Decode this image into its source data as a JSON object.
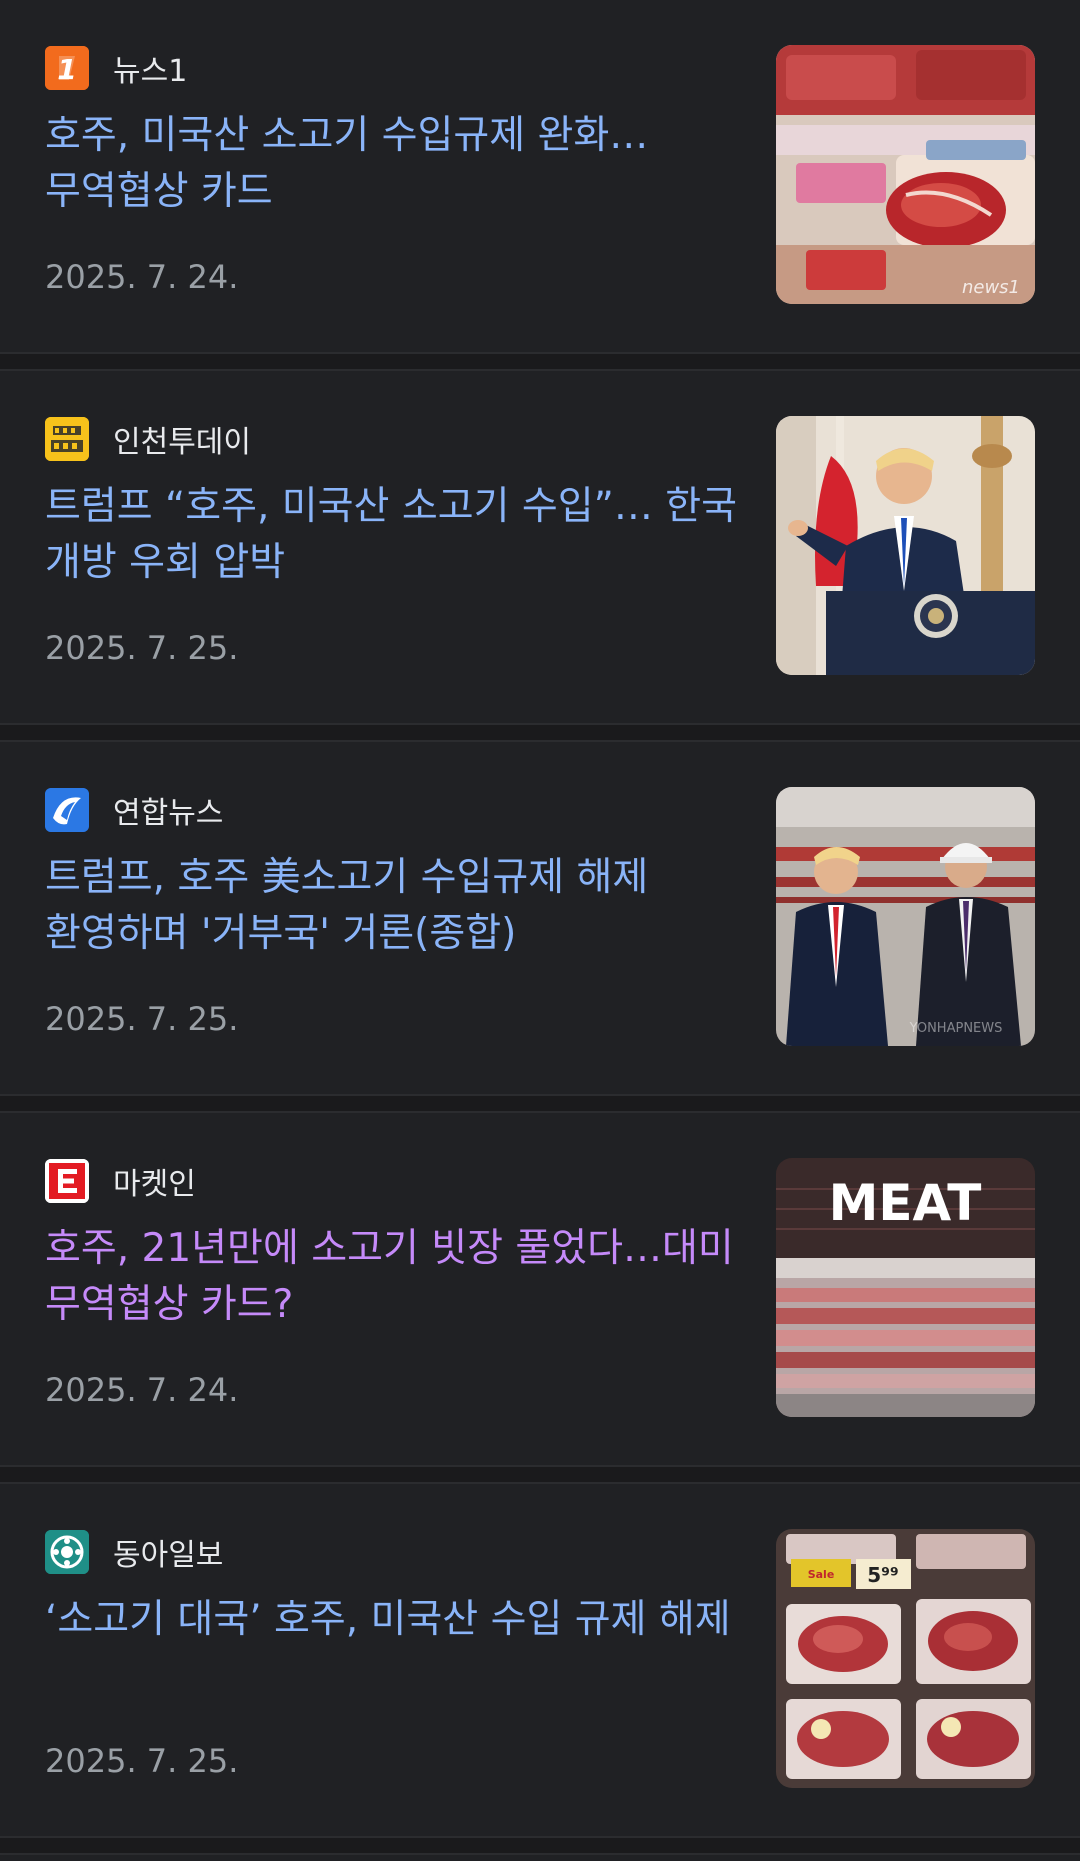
{
  "articles": [
    {
      "source": "뉴스1",
      "logo_icon": "news1-logo-icon",
      "headline": "호주, 미국산 소고기 수입규제 완화…무역협상 카드",
      "date": "2025. 7. 24.",
      "visited": false,
      "thumbnail": "raw-beef-steak-package-thumbnail"
    },
    {
      "source": "인천투데이",
      "logo_icon": "incheon-today-logo-icon",
      "headline": "트럼프 “호주, 미국산 소고기 수입”… 한국 개방 우회 압박",
      "date": "2025. 7. 25.",
      "visited": false,
      "thumbnail": "president-at-podium-thumbnail"
    },
    {
      "source": "연합뉴스",
      "logo_icon": "yonhap-logo-icon",
      "headline": "트럼프, 호주 美소고기 수입규제 해제 환영하며 '거부국' 거론(종합)",
      "date": "2025. 7. 25.",
      "visited": false,
      "thumbnail": "two-men-at-meat-plant-thumbnail"
    },
    {
      "source": "마켓인",
      "logo_icon": "marketin-logo-icon",
      "headline": "호주, 21년만에 소고기 빗장 풀었다…대미 무역협상 카드?",
      "date": "2025. 7. 24.",
      "visited": true,
      "thumbnail": "meat-counter-sign-thumbnail"
    },
    {
      "source": "동아일보",
      "logo_icon": "donga-logo-icon",
      "headline": "‘소고기 대국’ 호주, 미국산 수입 규제 해제",
      "date": "2025. 7. 25.",
      "visited": false,
      "thumbnail": "beef-packs-in-display-thumbnail"
    }
  ],
  "thumbnail_texts": {
    "meat_sign": "MEAT",
    "price_tag": "5⁹⁹"
  },
  "colors": {
    "background": "#202124",
    "headline_link": "#8ab4f8",
    "headline_visited": "#c58af9",
    "date_text": "#9aa0a6",
    "source_text": "#e8eaed"
  }
}
